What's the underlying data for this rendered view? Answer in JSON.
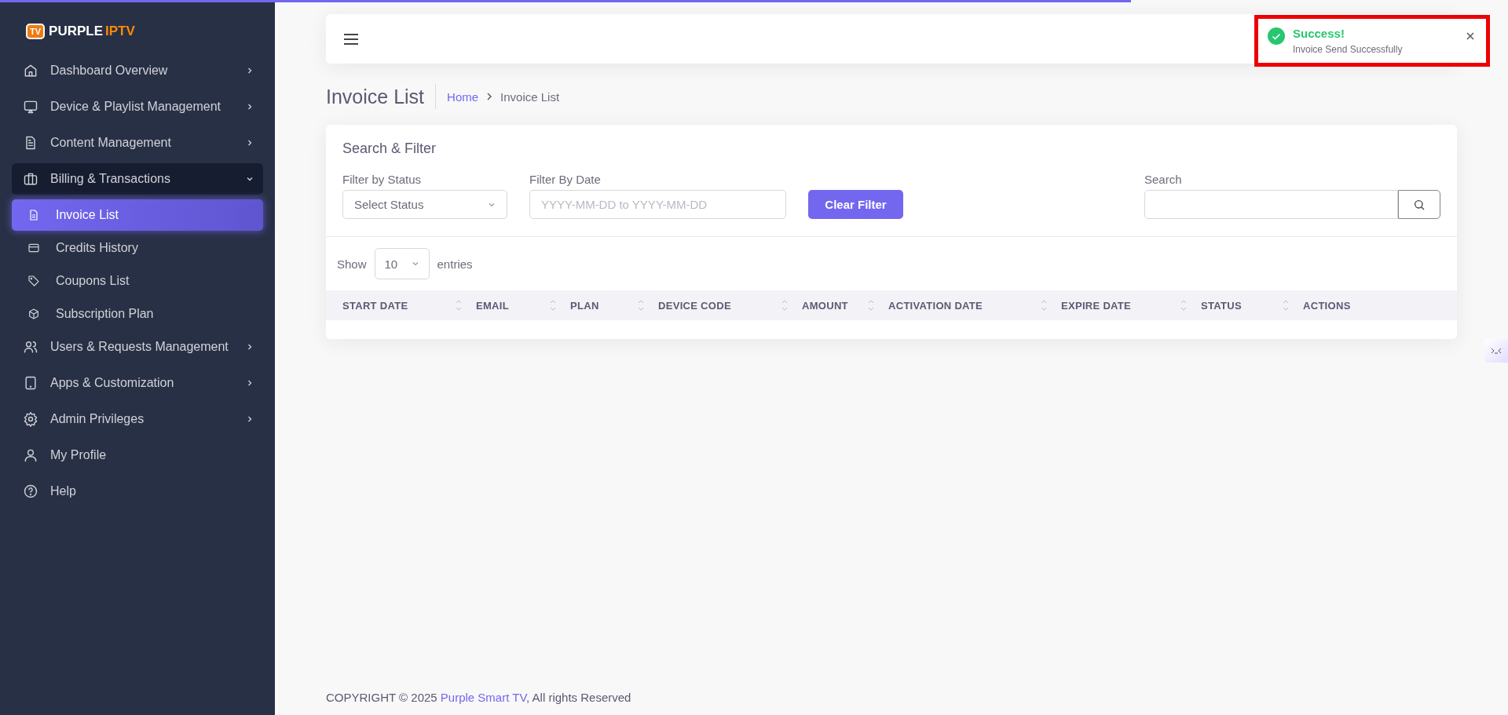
{
  "progress": {
    "level": 0.75
  },
  "brand": {
    "part1": "PURPLE",
    "part2": "IPTV",
    "badge": "TV"
  },
  "sidebar": {
    "items": [
      {
        "label": "Dashboard Overview",
        "expanded": false,
        "has_arrow": true
      },
      {
        "label": "Device & Playlist Management",
        "expanded": false,
        "has_arrow": true
      },
      {
        "label": "Content Management",
        "expanded": false,
        "has_arrow": true
      },
      {
        "label": "Billing & Transactions",
        "expanded": true,
        "has_arrow": true,
        "children": [
          {
            "label": "Invoice List",
            "selected": true
          },
          {
            "label": "Credits History",
            "selected": false
          },
          {
            "label": "Coupons List",
            "selected": false
          },
          {
            "label": "Subscription Plan",
            "selected": false
          }
        ]
      },
      {
        "label": "Users & Requests Management",
        "expanded": false,
        "has_arrow": true
      },
      {
        "label": "Apps & Customization",
        "expanded": false,
        "has_arrow": true
      },
      {
        "label": "Admin Privileges",
        "expanded": false,
        "has_arrow": true
      },
      {
        "label": "My Profile",
        "expanded": false,
        "has_arrow": false
      },
      {
        "label": "Help",
        "expanded": false,
        "has_arrow": false
      }
    ]
  },
  "page": {
    "title": "Invoice List",
    "breadcrumb": [
      {
        "label": "Home",
        "link": true
      },
      {
        "label": "Invoice List",
        "link": false
      }
    ]
  },
  "filter": {
    "title": "Search & Filter",
    "status": {
      "label": "Filter by Status",
      "value": "Select Status"
    },
    "date": {
      "label": "Filter By Date",
      "placeholder": "YYYY-MM-DD to YYYY-MM-DD"
    },
    "clear_button": "Clear Filter",
    "search": {
      "label": "Search"
    }
  },
  "table": {
    "show_label": "Show",
    "page_size": "10",
    "entries_label": "entries",
    "columns": [
      {
        "label": "START DATE",
        "sortable": true
      },
      {
        "label": "EMAIL",
        "sortable": true
      },
      {
        "label": "PLAN",
        "sortable": true
      },
      {
        "label": "DEVICE CODE",
        "sortable": true
      },
      {
        "label": "AMOUNT",
        "sortable": true
      },
      {
        "label": "ACTIVATION DATE",
        "sortable": true
      },
      {
        "label": "EXPIRE DATE",
        "sortable": true
      },
      {
        "label": "STATUS",
        "sortable": true
      },
      {
        "label": "ACTIONS",
        "sortable": false
      }
    ]
  },
  "toast": {
    "title": "Success!",
    "message": "Invoice Send Successfully"
  },
  "footer": {
    "prefix": "COPYRIGHT © 2025 ",
    "link": "Purple Smart TV",
    "suffix": ", All rights Reserved"
  }
}
